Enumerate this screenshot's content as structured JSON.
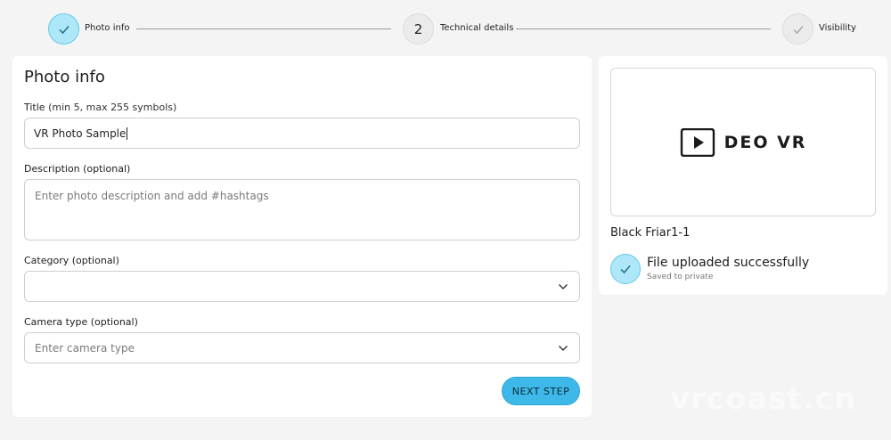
{
  "stepper": {
    "steps": [
      {
        "label": "Photo info",
        "state": "active"
      },
      {
        "number": "2",
        "label": "Technical details",
        "state": "pending"
      },
      {
        "label": "Visibility",
        "state": "pending"
      }
    ]
  },
  "form": {
    "heading": "Photo info",
    "title_field": {
      "label": "Title",
      "hint": "(min 5, max 255 symbols)",
      "value": "VR Photo Sample"
    },
    "description_field": {
      "label": "Description (optional)",
      "placeholder": "Enter photo description and add #hashtags"
    },
    "category_field": {
      "label": "Category (optional)",
      "value": ""
    },
    "camera_field": {
      "label": "Camera type (optional)",
      "placeholder": "Enter camera type"
    },
    "next_button": "NEXT STEP"
  },
  "preview": {
    "logo_text": "DEO VR",
    "file_name": "Black Friar1-1",
    "upload_status": "File uploaded successfully",
    "upload_sub": "Saved to private"
  },
  "watermark": "vrcoast.cn",
  "colors": {
    "accent": "#3eb8e8",
    "accent_light": "#aee7f8",
    "background": "#f4f4f4"
  },
  "icons": [
    "check-icon",
    "chevron-down-icon",
    "play-icon"
  ]
}
